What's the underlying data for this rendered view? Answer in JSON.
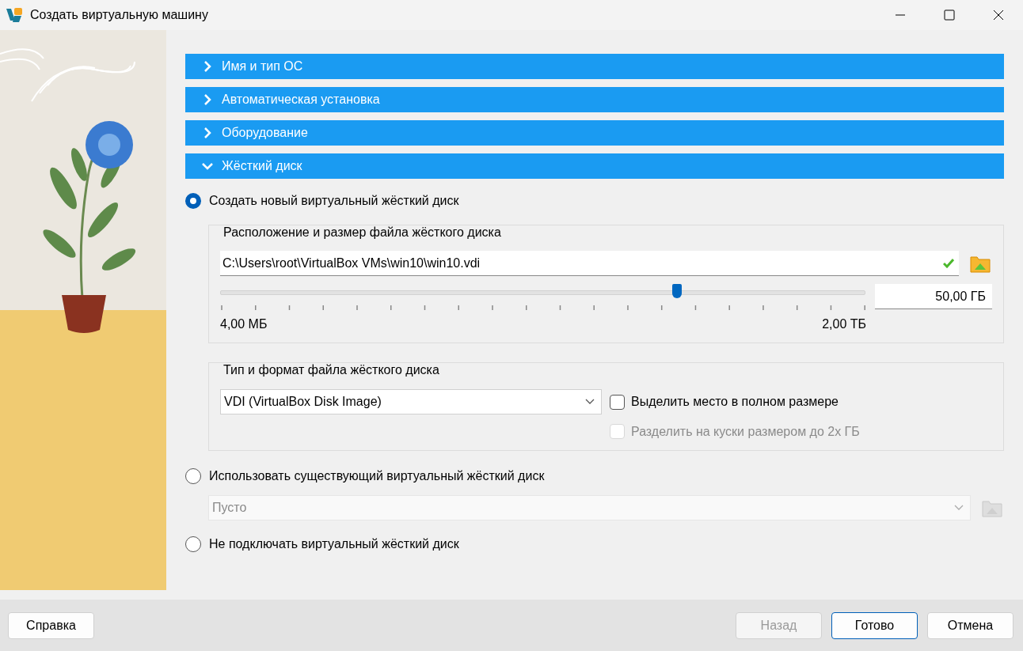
{
  "window": {
    "title": "Создать виртуальную машину"
  },
  "sections": [
    {
      "label": "Имя и тип ОС",
      "expanded": false
    },
    {
      "label": "Автоматическая установка",
      "expanded": false
    },
    {
      "label": "Оборудование",
      "expanded": false
    },
    {
      "label": "Жёсткий диск",
      "expanded": true
    }
  ],
  "disk_options": [
    {
      "label": "Создать новый виртуальный жёсткий диск",
      "selected": true,
      "location_group": {
        "title": "Расположение и размер файла жёсткого диска",
        "path": "C:\\Users\\root\\VirtualBox VMs\\win10\\win10.vdi",
        "size_slider": {
          "level": 0.708
        },
        "size_value": "50,00 ГБ",
        "min_label": "4,00 МБ",
        "max_label": "2,00 ТБ"
      },
      "format_group": {
        "title": "Тип и формат файла жёсткого диска",
        "format": "VDI (VirtualBox Disk Image)",
        "options": [
          {
            "label": "Выделить место в полном размере",
            "checked": false,
            "disabled": false
          },
          {
            "label": "Разделить на куски размером до 2х ГБ",
            "checked": false,
            "disabled": true
          }
        ]
      }
    },
    {
      "label": "Использовать существующий виртуальный жёсткий диск",
      "selected": false,
      "existing_disk": {
        "value": "Пусто",
        "disabled": true
      }
    },
    {
      "label": "Не подключать виртуальный жёсткий диск",
      "selected": false
    }
  ],
  "help_button": {
    "label": "Справка"
  },
  "buttons": [
    {
      "label": "Назад",
      "disabled": true,
      "default": false
    },
    {
      "label": "Готово",
      "disabled": false,
      "default": true
    },
    {
      "label": "Отмена",
      "disabled": false,
      "default": false
    }
  ]
}
